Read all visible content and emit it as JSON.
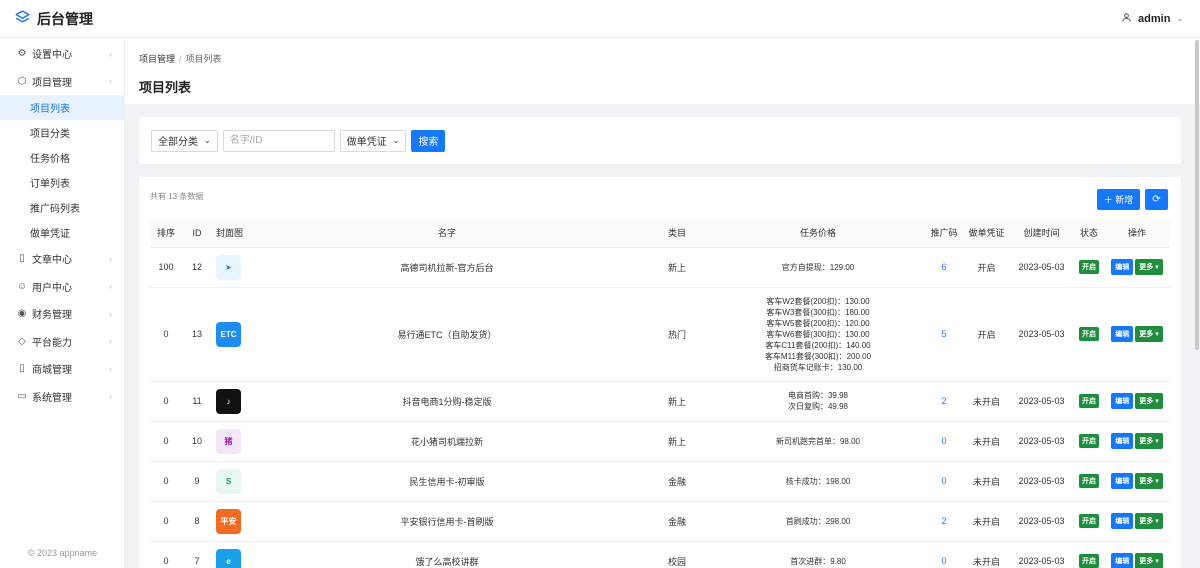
{
  "app": {
    "title": "后台管理",
    "user": "admin"
  },
  "sidebar": {
    "items": [
      {
        "label": "设置中心",
        "icon": "gear-icon"
      },
      {
        "label": "项目管理",
        "icon": "cube-icon",
        "children": [
          "项目列表",
          "项目分类",
          "任务价格",
          "订单列表",
          "推广码列表",
          "做单凭证"
        ]
      },
      {
        "label": "文章中心",
        "icon": "book-icon"
      },
      {
        "label": "用户中心",
        "icon": "user-icon"
      },
      {
        "label": "财务管理",
        "icon": "coin-icon"
      },
      {
        "label": "平台能力",
        "icon": "layers-icon"
      },
      {
        "label": "商城管理",
        "icon": "book-icon"
      },
      {
        "label": "系统管理",
        "icon": "monitor-icon"
      }
    ],
    "active_child": "项目列表",
    "copyright": "© 2023 appname"
  },
  "breadcrumb": {
    "parent": "项目管理",
    "current": "项目列表"
  },
  "page_title": "项目列表",
  "search": {
    "category_select": "全部分类",
    "keyword_placeholder": "名字/ID",
    "credential_select": "做单凭证",
    "search_label": "搜索"
  },
  "table": {
    "total_text": "共有 13 条数据",
    "add_label": "＋ 新增",
    "columns": [
      "排序",
      "ID",
      "封面图",
      "名字",
      "类目",
      "任务价格",
      "推广码",
      "做单凭证",
      "创建时间",
      "状态",
      "操作"
    ],
    "edit_label": "编辑",
    "more_label": "更多 ▾",
    "rows": [
      {
        "sort": "100",
        "id": "12",
        "name": "高德司机拉新-官方后台",
        "category": "新上",
        "prices": [
          "官方自提现：129.00"
        ],
        "code": "6",
        "credential": "开启",
        "created": "2023-05-03",
        "status": "开启",
        "cover": {
          "bg": "#e8f4ff",
          "fg": "#1677ff",
          "text": "➤"
        }
      },
      {
        "sort": "0",
        "id": "13",
        "name": "易行通ETC（自助发货）",
        "category": "热门",
        "prices": [
          "客车W2套餐(200扣)：130.00",
          "客车W3套餐(300扣)：180.00",
          "客车W5套餐(200扣)：120.00",
          "客车W6套餐(300扣)：130.00",
          "客车C11套餐(200扣)：140.00",
          "客车M11套餐(300扣)：200.00",
          "招商货车记账卡：130.00"
        ],
        "code": "5",
        "credential": "开启",
        "created": "2023-05-03",
        "status": "开启",
        "cover": {
          "bg": "#1e8cf0",
          "fg": "#ffffff",
          "text": "ETC"
        }
      },
      {
        "sort": "0",
        "id": "11",
        "name": "抖音电商1分购-稳定版",
        "category": "新上",
        "prices": [
          "电商首购：39.98",
          "次日复购：49.98"
        ],
        "code": "2",
        "credential": "未开启",
        "created": "2023-05-03",
        "status": "开启",
        "cover": {
          "bg": "#111111",
          "fg": "#ffffff",
          "text": "♪"
        }
      },
      {
        "sort": "0",
        "id": "10",
        "name": "花小猪司机端拉新",
        "category": "新上",
        "prices": [
          "新司机跑完首单：98.00"
        ],
        "code": "0",
        "credential": "未开启",
        "created": "2023-05-03",
        "status": "开启",
        "cover": {
          "bg": "#f3e6f7",
          "fg": "#a01aa8",
          "text": "猪"
        }
      },
      {
        "sort": "0",
        "id": "9",
        "name": "民生信用卡-初审版",
        "category": "金融",
        "prices": [
          "核卡成功：198.00"
        ],
        "code": "0",
        "credential": "未开启",
        "created": "2023-05-03",
        "status": "开启",
        "cover": {
          "bg": "#e9f7f1",
          "fg": "#0a9c6a",
          "text": "S"
        }
      },
      {
        "sort": "0",
        "id": "8",
        "name": "平安银行信用卡-首刷版",
        "category": "金融",
        "prices": [
          "首刷成功：298.00"
        ],
        "code": "2",
        "credential": "未开启",
        "created": "2023-05-03",
        "status": "开启",
        "cover": {
          "bg": "#f26b21",
          "fg": "#ffffff",
          "text": "平安"
        }
      },
      {
        "sort": "0",
        "id": "7",
        "name": "饿了么高校讲群",
        "category": "校园",
        "prices": [
          "首次进群：9.80"
        ],
        "code": "0",
        "credential": "未开启",
        "created": "2023-05-03",
        "status": "开启",
        "cover": {
          "bg": "#1aa0e8",
          "fg": "#ffffff",
          "text": "e"
        }
      }
    ]
  }
}
